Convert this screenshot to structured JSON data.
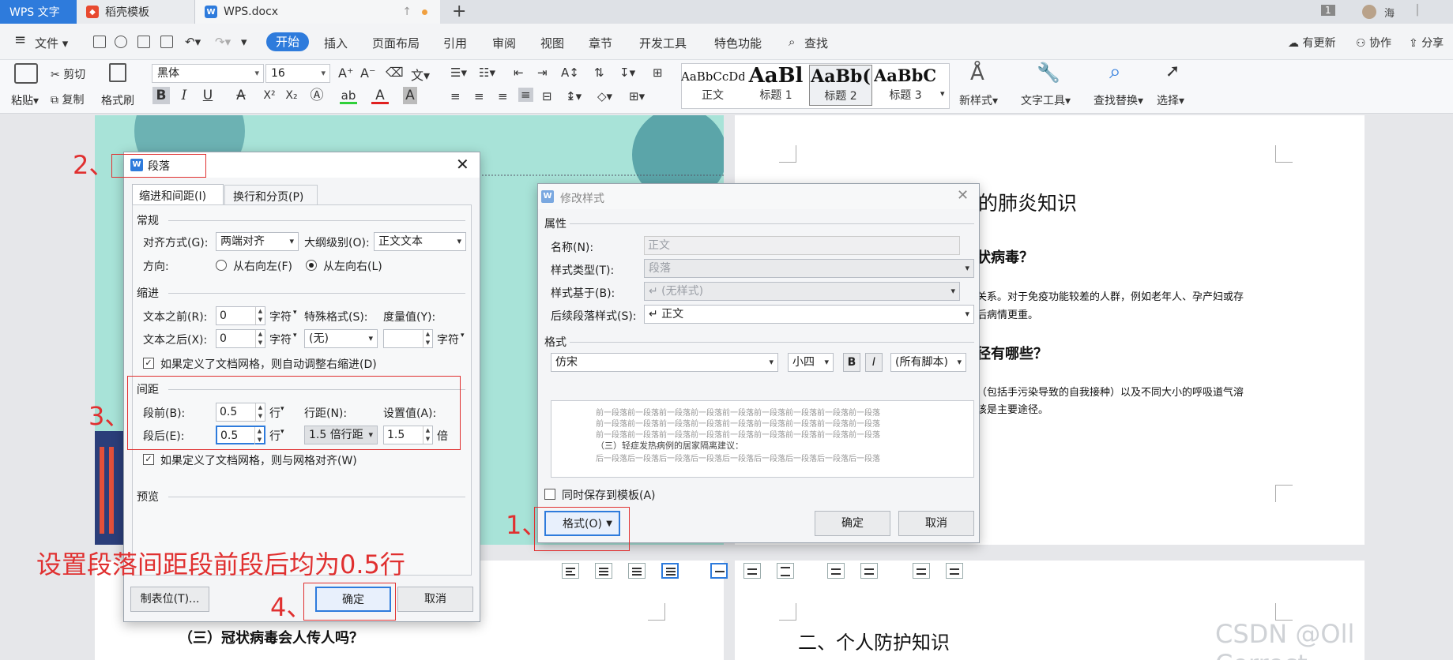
{
  "tabs": {
    "app": "WPS 文字",
    "template": "稻壳模板",
    "document": "WPS.docx",
    "count_badge": "1",
    "user": "海"
  },
  "menu": {
    "file": "文件",
    "items": [
      "开始",
      "插入",
      "页面布局",
      "引用",
      "审阅",
      "视图",
      "章节",
      "开发工具",
      "特色功能",
      "查找"
    ],
    "right": [
      "有更新",
      "协作",
      "分享"
    ]
  },
  "ribbon": {
    "paste": "粘贴",
    "cut": "剪切",
    "copy": "复制",
    "format_painter": "格式刷",
    "font_name": "黑体",
    "font_size": "16",
    "styles": [
      {
        "preview": "AaBbCcDd",
        "name": "正文"
      },
      {
        "preview": "AaBl",
        "name": "标题 1"
      },
      {
        "preview": "AaBb(",
        "name": "标题 2"
      },
      {
        "preview": "AaBbC(",
        "name": "标题 3"
      }
    ],
    "new_style": "新样式",
    "text_tools": "文字工具",
    "find_replace": "查找替换",
    "select": "选择"
  },
  "doc": {
    "right_title": "的肺炎知识",
    "right_q1": "状病毒？",
    "right_p1a": "关系。对于免疫功能较差的人群，例如老年人、孕产妇或存",
    "right_p1b": "后病情更重。",
    "right_q2": "径有哪些？",
    "right_p2a": "（包括手污染导致的自我接种）以及不同大小的呼吸道气溶",
    "right_p2b": "该是主要途径。",
    "bottom_left": "（三）冠状病毒会人传人吗？",
    "bottom_right": "二、个人防护知识",
    "watermark": "CSDN @Oll Correct"
  },
  "para_dialog": {
    "title": "段落",
    "tab_indent": "缩进和间距(I)",
    "tab_break": "换行和分页(P)",
    "sec_general": "常规",
    "align_label": "对齐方式(G):",
    "align_value": "两端对齐",
    "outline_label": "大纲级别(O):",
    "outline_value": "正文文本",
    "direction_label": "方向:",
    "rtl": "从右向左(F)",
    "ltr": "从左向右(L)",
    "sec_indent": "缩进",
    "before_text": "文本之前(R):",
    "before_text_value": "0",
    "unit_char": "字符",
    "special_label": "特殊格式(S):",
    "special_value": "(无)",
    "measure_label": "度量值(Y):",
    "after_text": "文本之后(X):",
    "after_text_value": "0",
    "auto_indent": "如果定义了文档网格，则自动调整右缩进(D)",
    "sec_spacing": "间距",
    "space_before_label": "段前(B):",
    "space_before_value": "0.5",
    "unit_line": "行",
    "line_spacing_label": "行距(N):",
    "line_spacing_value": "1.5 倍行距",
    "set_value_label": "设置值(A):",
    "set_value": "1.5",
    "unit_times": "倍",
    "space_after_label": "段后(E):",
    "space_after_value": "0.5",
    "grid_align": "如果定义了文档网格，则与网格对齐(W)",
    "sec_preview": "预览",
    "tabs_button": "制表位(T)...",
    "ok": "确定",
    "cancel": "取消"
  },
  "style_dialog": {
    "title": "修改样式",
    "sec_props": "属性",
    "name_label": "名称(N):",
    "name_value": "正文",
    "type_label": "样式类型(T):",
    "type_value": "段落",
    "based_label": "样式基于(B):",
    "based_value": "↵ (无样式)",
    "next_label": "后续段落样式(S):",
    "next_value": "↵ 正文",
    "sec_format": "格式",
    "font": "仿宋",
    "size": "小四",
    "bold": "B",
    "italic": "I",
    "script": "(所有脚本)",
    "preview_lines": [
      "前一段落前一段落前一段落前一段落前一段落前一段落前一段落前一段落前一段落",
      "前一段落前一段落前一段落前一段落前一段落前一段落前一段落前一段落前一段落",
      "前一段落前一段落前一段落前一段落前一段落前一段落前一段落前一段落前一段落",
      "（三）轻症发热病例的居家隔离建议：",
      "后一段落后一段落后一段落后一段落后一段落后一段落后一段落后一段落后一段落"
    ],
    "save_template": "同时保存到模板(A)",
    "format_button": "格式(O)",
    "ok": "确定",
    "cancel": "取消"
  },
  "annotations": {
    "step1": "1、",
    "step2": "2、",
    "step3": "3、",
    "step4": "4、",
    "caption": "设置段落间距段前段后均为0.5行",
    "color": "#e03030"
  }
}
